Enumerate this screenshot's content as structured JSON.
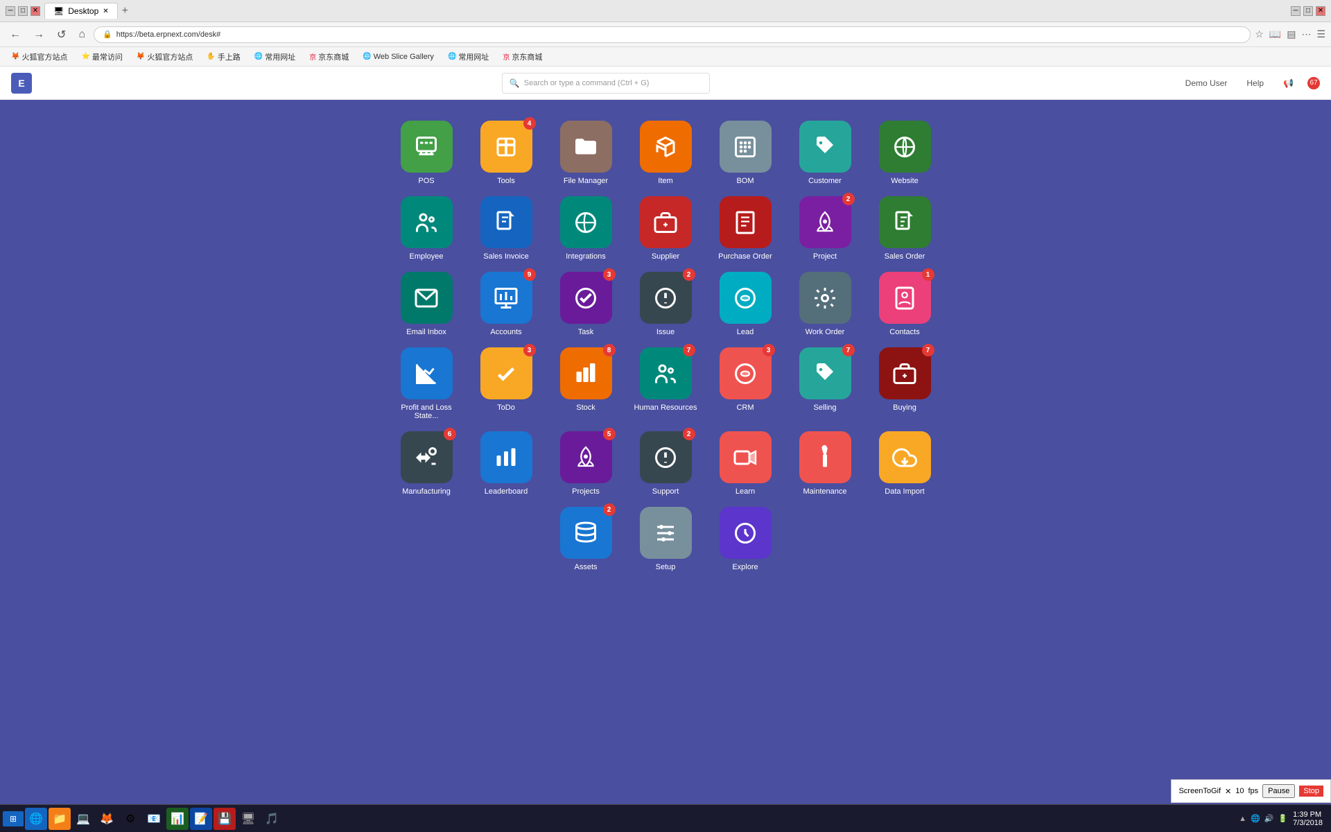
{
  "browser": {
    "tab_title": "Desktop",
    "url": "https://beta.erpnext.com/desk#",
    "new_tab_label": "+",
    "nav": {
      "back": "←",
      "forward": "→",
      "refresh": "↺",
      "home": "⌂"
    }
  },
  "bookmarks": [
    {
      "label": "火狐官方站点",
      "icon": "🦊"
    },
    {
      "label": "最常访问",
      "icon": "⭐"
    },
    {
      "label": "火狐官方站点",
      "icon": "🦊"
    },
    {
      "label": "手上路",
      "icon": "✋"
    },
    {
      "label": "常用网址",
      "icon": "🌐"
    },
    {
      "label": "京东商城",
      "icon": "🛒"
    },
    {
      "label": "Web Slice Gallery",
      "icon": "🌐"
    },
    {
      "label": "常用网址",
      "icon": "🌐"
    },
    {
      "label": "京东商城",
      "icon": "🛒"
    }
  ],
  "header": {
    "logo": "E",
    "search_placeholder": "Search or type a command (Ctrl + G)",
    "user": "Demo User",
    "help": "Help",
    "notification_count": "67"
  },
  "apps": {
    "rows": [
      [
        {
          "id": "pos",
          "label": "POS",
          "color": "bg-green",
          "badge": null,
          "icon": "pos"
        },
        {
          "id": "tools",
          "label": "Tools",
          "color": "bg-yellow",
          "badge": "4",
          "icon": "tools"
        },
        {
          "id": "file-manager",
          "label": "File Manager",
          "color": "bg-brown",
          "badge": null,
          "icon": "folder"
        },
        {
          "id": "item",
          "label": "Item",
          "color": "bg-orange",
          "badge": null,
          "icon": "box"
        },
        {
          "id": "bom",
          "label": "BOM",
          "color": "bg-gray",
          "badge": null,
          "icon": "bom"
        },
        {
          "id": "customer",
          "label": "Customer",
          "color": "bg-teal",
          "badge": null,
          "icon": "tag"
        },
        {
          "id": "website",
          "label": "Website",
          "color": "bg-green2",
          "badge": null,
          "icon": "globe"
        }
      ],
      [
        {
          "id": "employee",
          "label": "Employee",
          "color": "bg-green3",
          "badge": null,
          "icon": "people"
        },
        {
          "id": "sales-invoice",
          "label": "Sales Invoice",
          "color": "bg-blue",
          "badge": null,
          "icon": "document"
        },
        {
          "id": "integrations",
          "label": "Integrations",
          "color": "bg-green3",
          "badge": null,
          "icon": "integrations"
        },
        {
          "id": "supplier",
          "label": "Supplier",
          "color": "bg-red",
          "badge": null,
          "icon": "briefcase"
        },
        {
          "id": "purchase-order",
          "label": "Purchase Order",
          "color": "bg-darkred",
          "badge": null,
          "icon": "purchaseorder"
        },
        {
          "id": "project",
          "label": "Project",
          "color": "bg-purple",
          "badge": "2",
          "icon": "rocket"
        },
        {
          "id": "sales-order",
          "label": "Sales Order",
          "color": "bg-green2",
          "badge": null,
          "icon": "document2"
        }
      ],
      [
        {
          "id": "email-inbox",
          "label": "Email Inbox",
          "color": "bg-teal2",
          "badge": null,
          "icon": "email"
        },
        {
          "id": "accounts",
          "label": "Accounts",
          "color": "bg-blue2",
          "badge": "9",
          "icon": "accounts"
        },
        {
          "id": "task",
          "label": "Task",
          "color": "bg-violet",
          "badge": "3",
          "icon": "check"
        },
        {
          "id": "issue",
          "label": "Issue",
          "color": "bg-darkgray",
          "badge": "2",
          "icon": "alert"
        },
        {
          "id": "lead",
          "label": "Lead",
          "color": "bg-cyan",
          "badge": null,
          "icon": "lead"
        },
        {
          "id": "work-order",
          "label": "Work Order",
          "color": "bg-greengray",
          "badge": null,
          "icon": "gear"
        },
        {
          "id": "contacts",
          "label": "Contacts",
          "color": "bg-pinksalmon",
          "badge": "1",
          "icon": "contacts"
        }
      ],
      [
        {
          "id": "profit-loss",
          "label": "Profit and Loss State...",
          "color": "bg-blue2",
          "badge": null,
          "icon": "chart"
        },
        {
          "id": "todo",
          "label": "ToDo",
          "color": "bg-yellow",
          "badge": "3",
          "icon": "checkmark"
        },
        {
          "id": "stock",
          "label": "Stock",
          "color": "bg-orange",
          "badge": "8",
          "icon": "stock"
        },
        {
          "id": "human-resources",
          "label": "Human Resources",
          "color": "bg-green3",
          "badge": "7",
          "icon": "hr"
        },
        {
          "id": "crm",
          "label": "CRM",
          "color": "bg-salmon",
          "badge": "3",
          "icon": "lead"
        },
        {
          "id": "selling",
          "label": "Selling",
          "color": "bg-teal",
          "badge": "7",
          "icon": "tag"
        },
        {
          "id": "buying",
          "label": "Buying",
          "color": "bg-darkred2",
          "badge": "7",
          "icon": "buying"
        }
      ],
      [
        {
          "id": "manufacturing",
          "label": "Manufacturing",
          "color": "bg-darkgray",
          "badge": "6",
          "icon": "manufacturing"
        },
        {
          "id": "leaderboard",
          "label": "Leaderboard",
          "color": "bg-blue2",
          "badge": null,
          "icon": "leaderboard"
        },
        {
          "id": "projects",
          "label": "Projects",
          "color": "bg-violet",
          "badge": "5",
          "icon": "rocket"
        },
        {
          "id": "support",
          "label": "Support",
          "color": "bg-darkgray",
          "badge": "2",
          "icon": "alert"
        },
        {
          "id": "learn",
          "label": "Learn",
          "color": "bg-salmon",
          "badge": null,
          "icon": "video"
        },
        {
          "id": "maintenance",
          "label": "Maintenance",
          "color": "bg-salmon",
          "badge": null,
          "icon": "tools2"
        },
        {
          "id": "data-import",
          "label": "Data Import",
          "color": "bg-yellow",
          "badge": null,
          "icon": "cloud"
        }
      ],
      [
        {
          "id": "assets",
          "label": "Assets",
          "color": "bg-blue2",
          "badge": "2",
          "icon": "database"
        },
        {
          "id": "setup",
          "label": "Setup",
          "color": "bg-gray",
          "badge": null,
          "icon": "setup"
        },
        {
          "id": "explore",
          "label": "Explore",
          "color": "bg-blueviolet",
          "badge": null,
          "icon": "telescope"
        }
      ]
    ]
  },
  "taskbar": {
    "start_icon": "⊞",
    "time": "1:39 PM",
    "date": "7/3/2018",
    "icons": [
      "🌐",
      "📁",
      "💻",
      "🦊",
      "⚙",
      "📧",
      "📊",
      "📝",
      "💾",
      "🖥",
      "🎵"
    ]
  },
  "screenrecorder": {
    "label": "ScreenToGif",
    "fps_label": "fps",
    "fps_value": "10",
    "pause": "Pause",
    "stop": "Stop"
  }
}
